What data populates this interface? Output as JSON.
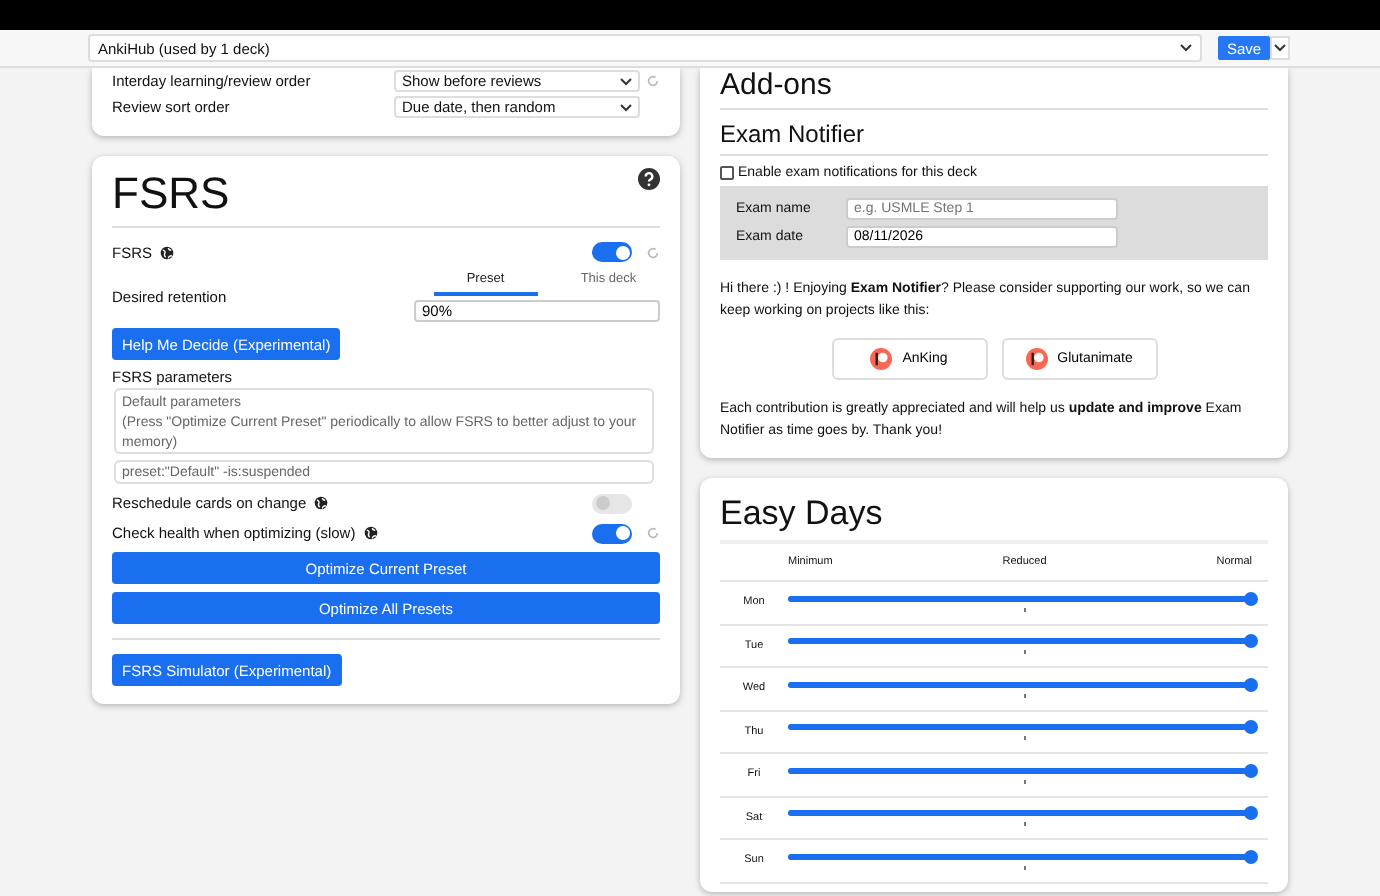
{
  "toolbar": {
    "preset": "AnkiHub (used by 1 deck)",
    "save": "Save"
  },
  "order_card": {
    "rows": [
      {
        "label": "Interday learning/review order",
        "value": "Show before reviews",
        "reset": true
      },
      {
        "label": "Review sort order",
        "value": "Due date, then random",
        "reset": false
      }
    ]
  },
  "fsrs": {
    "title": "FSRS",
    "toggle": {
      "label": "FSRS",
      "on": true,
      "reset": true
    },
    "retention": {
      "label": "Desired retention",
      "tabs": [
        {
          "label": "Preset",
          "selected": true
        },
        {
          "label": "This deck",
          "selected": false
        }
      ],
      "value": "90%"
    },
    "help_button": "Help Me Decide (Experimental)",
    "params_label": "FSRS parameters",
    "params_placeholder": "Default parameters\n(Press \"Optimize Current Preset\" periodically to allow FSRS to better adjust to your memory)",
    "search": "preset:\"Default\" -is:suspended",
    "options": [
      {
        "label": "Reschedule cards on change",
        "on": false,
        "reset": false
      },
      {
        "label": "Check health when optimizing (slow)",
        "on": true,
        "reset": true
      }
    ],
    "buttons": [
      "Optimize Current Preset",
      "Optimize All Presets"
    ],
    "simulator_button": "FSRS Simulator (Experimental)"
  },
  "addons": {
    "title": "Add-ons",
    "exam_notifier": {
      "title": "Exam Notifier",
      "enable": {
        "label": "Enable exam notifications for this deck",
        "checked": false
      },
      "fields": [
        {
          "label": "Exam name",
          "placeholder": "e.g. USMLE Step 1"
        },
        {
          "label": "Exam date",
          "value": "08/11/2026"
        }
      ],
      "support_text": "Hi there :) ! Enjoying **Exam Notifier**? Please consider supporting our work, so we can keep working on projects like this:",
      "support_buttons": [
        "AnKing",
        "Glutanimate"
      ],
      "thanks": "Each contribution is greatly appreciated and will help us **update and improve** Exam Notifier as time goes by. Thank you!"
    }
  },
  "easy_days": {
    "title": "Easy Days",
    "columns": [
      "Minimum",
      "Reduced",
      "Normal"
    ],
    "days": [
      {
        "day": "Mon",
        "level": 1
      },
      {
        "day": "Tue",
        "level": 1
      },
      {
        "day": "Wed",
        "level": 1
      },
      {
        "day": "Thu",
        "level": 1
      },
      {
        "day": "Fri",
        "level": 1
      },
      {
        "day": "Sat",
        "level": 1
      },
      {
        "day": "Sun",
        "level": 1
      }
    ]
  }
}
